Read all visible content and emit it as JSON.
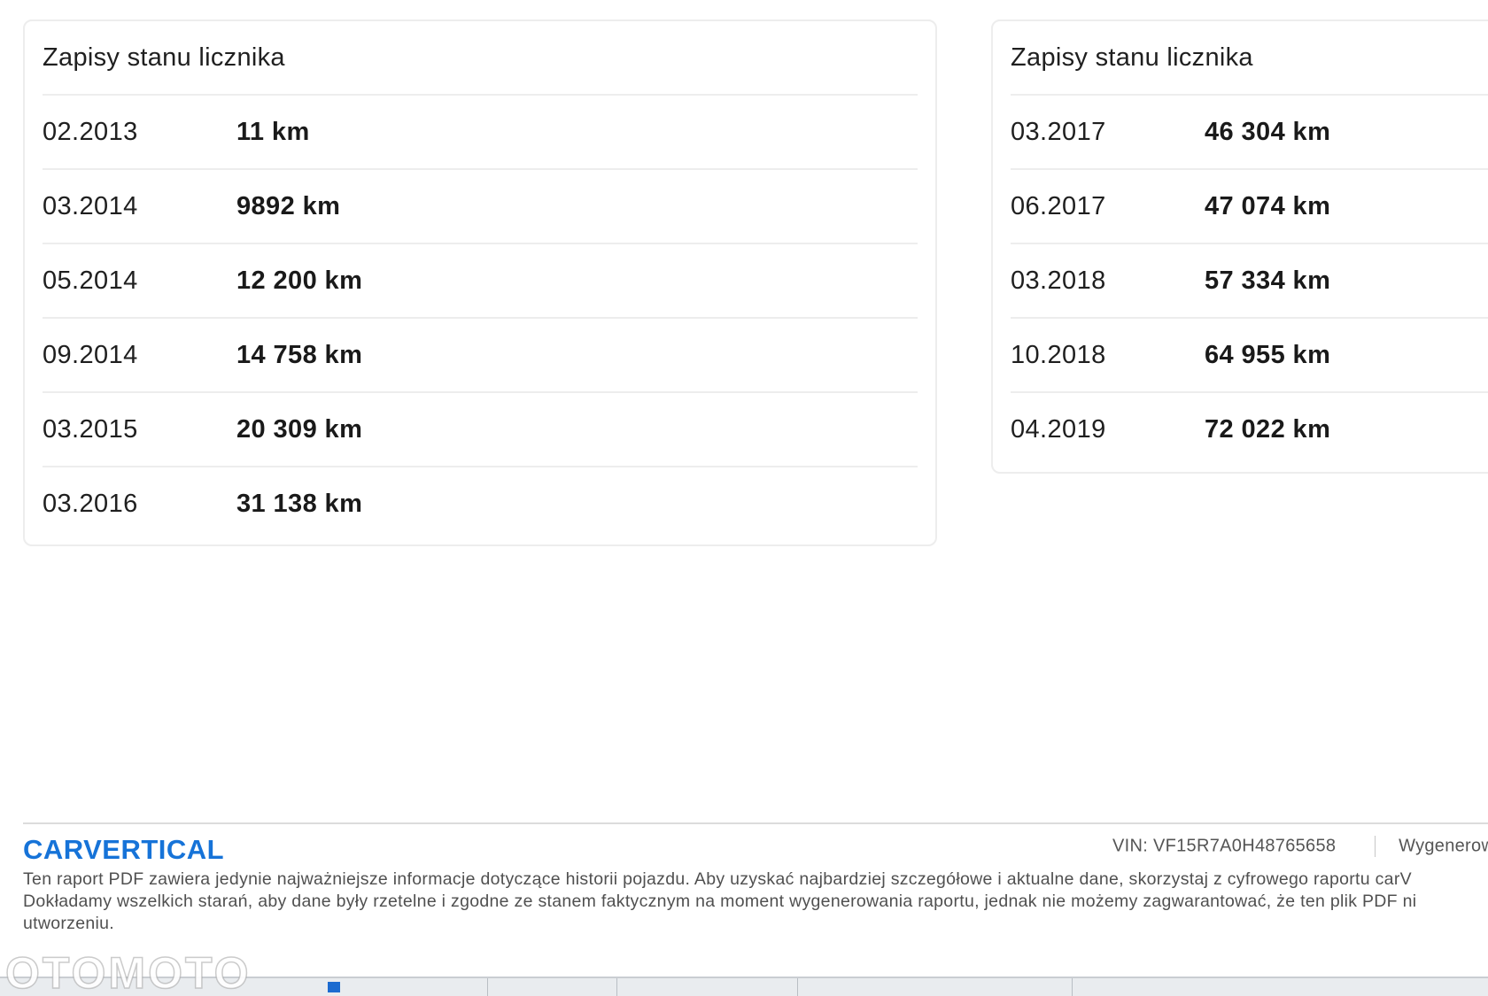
{
  "cards": [
    {
      "title": "Zapisy stanu licznika",
      "rows": [
        {
          "date": "02.2013",
          "value": "11 km"
        },
        {
          "date": "03.2014",
          "value": "9892 km"
        },
        {
          "date": "05.2014",
          "value": "12 200 km"
        },
        {
          "date": "09.2014",
          "value": "14 758 km"
        },
        {
          "date": "03.2015",
          "value": "20 309 km"
        },
        {
          "date": "03.2016",
          "value": "31 138 km"
        }
      ]
    },
    {
      "title": "Zapisy stanu licznika",
      "rows": [
        {
          "date": "03.2017",
          "value": "46 304 km"
        },
        {
          "date": "06.2017",
          "value": "47 074 km"
        },
        {
          "date": "03.2018",
          "value": "57 334 km"
        },
        {
          "date": "10.2018",
          "value": "64 955 km"
        },
        {
          "date": "04.2019",
          "value": "72 022 km"
        }
      ]
    }
  ],
  "footer": {
    "logo": "CARVERTICAL",
    "vin_label": "VIN:",
    "vin": "VF15R7A0H48765658",
    "generated_partial": "Wygenerow",
    "disclaimer_lines": [
      "Ten raport PDF zawiera jedynie najważniejsze informacje dotyczące historii pojazdu. Aby uzyskać najbardziej szczegółowe i aktualne dane, skorzystaj z cyfrowego raportu carV",
      "Dokładamy wszelkich starań, aby dane były rzetelne i zgodne ze stanem faktycznym na moment wygenerowania raportu, jednak nie możemy zagwarantować, że ten plik PDF ni",
      "utworzeniu."
    ]
  },
  "watermark": "OTOMOTO",
  "colors": {
    "brand": "#1673d8",
    "divider": "#ededed",
    "text": "#1f1f1f",
    "muted": "#505050"
  }
}
